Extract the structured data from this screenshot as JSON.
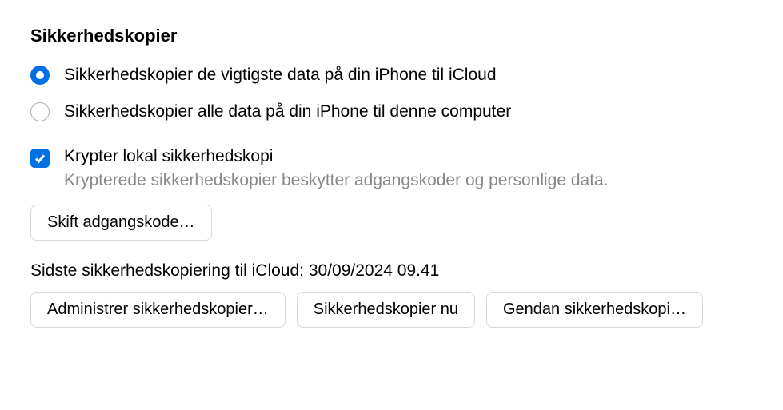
{
  "section": {
    "title": "Sikkerhedskopier"
  },
  "radios": {
    "icloud": {
      "label": "Sikkerhedskopier de vigtigste data på din iPhone til iCloud",
      "selected": true
    },
    "local": {
      "label": "Sikkerhedskopier alle data på din iPhone til denne computer",
      "selected": false
    }
  },
  "encrypt": {
    "label": "Krypter lokal sikkerhedskopi",
    "description": "Krypterede sikkerhedskopier beskytter adgangskoder og personlige data.",
    "checked": true
  },
  "buttons": {
    "change_password": "Skift adgangskode…",
    "manage_backups": "Administrer sikkerhedskopier…",
    "backup_now": "Sikkerhedskopier nu",
    "restore_backup": "Gendan sikkerhedskopi…"
  },
  "status": {
    "last_backup": "Sidste sikkerhedskopiering til iCloud: 30/09/2024 09.41"
  }
}
